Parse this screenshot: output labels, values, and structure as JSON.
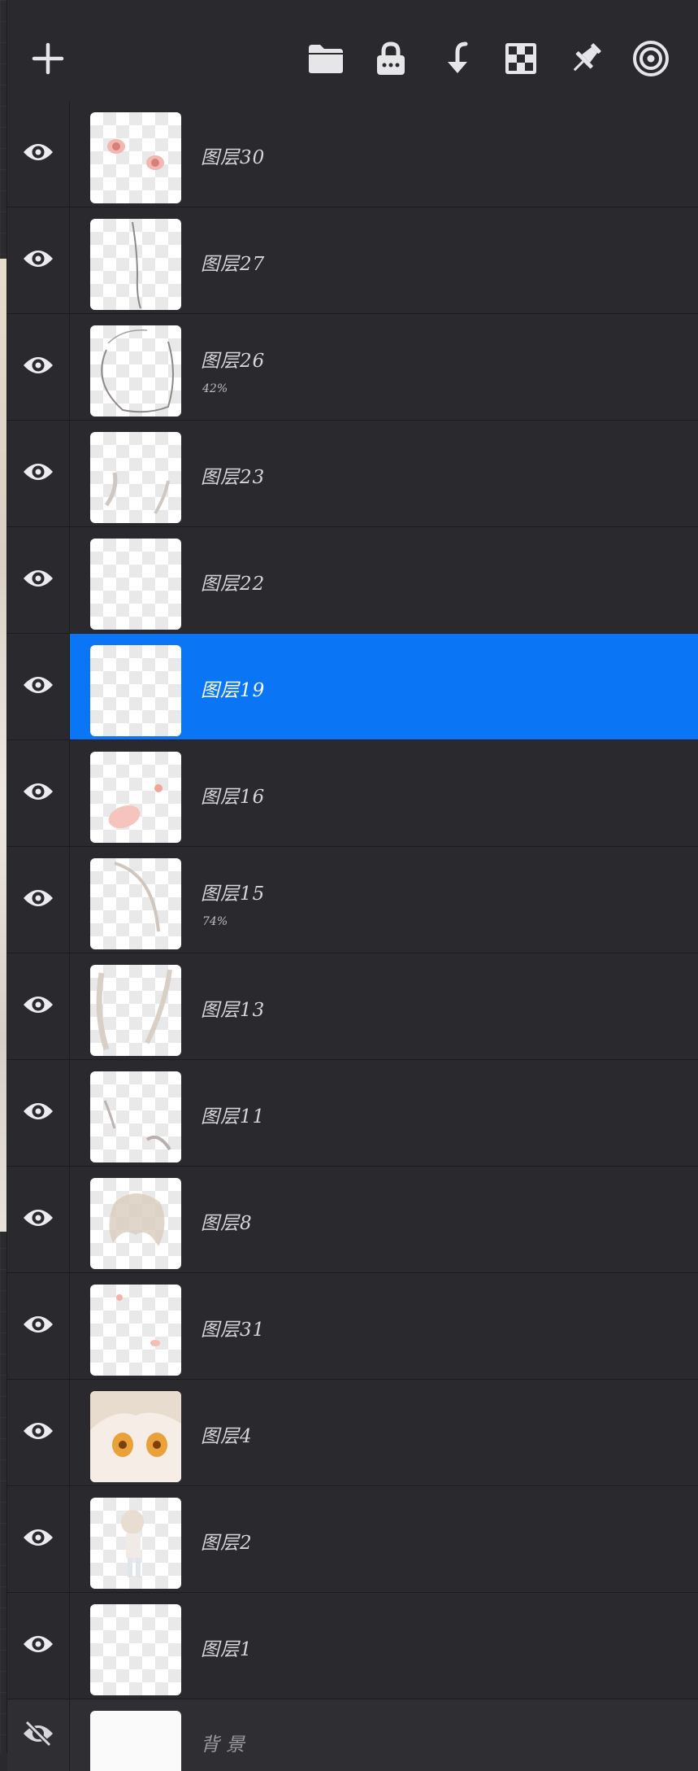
{
  "toolbar": {
    "buttons": [
      {
        "name": "add-layer-button",
        "icon": "plus-icon"
      },
      {
        "name": "group-folder-button",
        "icon": "folder-icon"
      },
      {
        "name": "lock-button",
        "icon": "lock-icon"
      },
      {
        "name": "merge-down-button",
        "icon": "merge-arrow-icon"
      },
      {
        "name": "alpha-lock-button",
        "icon": "checkerboard-icon"
      },
      {
        "name": "pin-button",
        "icon": "pin-icon"
      },
      {
        "name": "target-button",
        "icon": "target-icon"
      }
    ]
  },
  "layers": [
    {
      "name": "图层30",
      "opacity": "",
      "visible": true,
      "selected": false,
      "thumb": "eyes"
    },
    {
      "name": "图层27",
      "opacity": "",
      "visible": true,
      "selected": false,
      "thumb": "line"
    },
    {
      "name": "图层26",
      "opacity": "42%",
      "visible": true,
      "selected": false,
      "thumb": "circle"
    },
    {
      "name": "图层23",
      "opacity": "",
      "visible": true,
      "selected": false,
      "thumb": "wisps"
    },
    {
      "name": "图层22",
      "opacity": "",
      "visible": true,
      "selected": false,
      "thumb": "blank"
    },
    {
      "name": "图层19",
      "opacity": "",
      "visible": true,
      "selected": true,
      "thumb": "blank"
    },
    {
      "name": "图层16",
      "opacity": "",
      "visible": true,
      "selected": false,
      "thumb": "blush"
    },
    {
      "name": "图层15",
      "opacity": "74%",
      "visible": true,
      "selected": false,
      "thumb": "arc"
    },
    {
      "name": "图层13",
      "opacity": "",
      "visible": true,
      "selected": false,
      "thumb": "hair-sides"
    },
    {
      "name": "图层11",
      "opacity": "",
      "visible": true,
      "selected": false,
      "thumb": "strokes"
    },
    {
      "name": "图层8",
      "opacity": "",
      "visible": true,
      "selected": false,
      "thumb": "hair"
    },
    {
      "name": "图层31",
      "opacity": "",
      "visible": true,
      "selected": false,
      "thumb": "pink"
    },
    {
      "name": "图层4",
      "opacity": "",
      "visible": true,
      "selected": false,
      "thumb": "face"
    },
    {
      "name": "图层2",
      "opacity": "",
      "visible": true,
      "selected": false,
      "thumb": "figure"
    },
    {
      "name": "图层1",
      "opacity": "",
      "visible": true,
      "selected": false,
      "thumb": "blank"
    }
  ],
  "background_layer": {
    "name": "背景",
    "visible": false
  },
  "colors": {
    "selected": "#0a76f5",
    "panel": "#2a2a2e"
  }
}
